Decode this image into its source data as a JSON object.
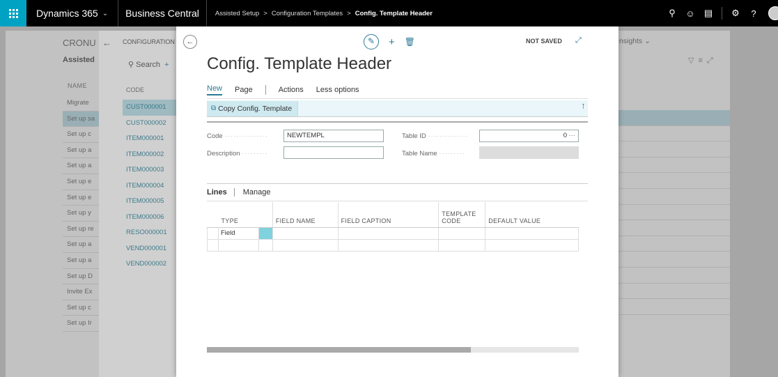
{
  "topbar": {
    "product": "Dynamics 365",
    "app": "Business Central",
    "breadcrumbs": [
      "Assisted Setup",
      "Configuration Templates",
      "Config. Template Header"
    ]
  },
  "background": {
    "company": "CRONU",
    "assisted": "Assisted",
    "name_header": "NAME",
    "rows": [
      "Migrate",
      "Set up sa",
      "Set up c",
      "Set up a",
      "Set up a",
      "Set up e",
      "Set up e",
      "Set up y",
      "Set up re",
      "Set up a",
      "Set up a",
      "Set up D",
      "Invite Ex",
      "Set up c",
      "Set up Ir"
    ],
    "selected_row": 1,
    "insights": "Insights"
  },
  "panel2": {
    "title": "CONFIGURATION TE",
    "search": "Search",
    "code_header": "CODE",
    "codes": [
      "CUST000001",
      "CUST000002",
      "ITEM000001",
      "ITEM000002",
      "ITEM000003",
      "ITEM000004",
      "ITEM000005",
      "ITEM000006",
      "RESO000001",
      "VEND000001",
      "VEND000002"
    ]
  },
  "dialog": {
    "status": "NOT SAVED",
    "title": "Config. Template Header",
    "actions": [
      "New",
      "Page",
      "Actions",
      "Less options"
    ],
    "copy_button": "Copy Config. Template",
    "fields": {
      "code_label": "Code",
      "code_value": "NEWTEMPL",
      "description_label": "Description",
      "description_value": "",
      "table_id_label": "Table ID",
      "table_id_value": "0",
      "table_name_label": "Table Name",
      "table_name_value": ""
    },
    "lines": {
      "tab_lines": "Lines",
      "tab_manage": "Manage",
      "columns": [
        "TYPE",
        "FIELD NAME",
        "FIELD CAPTION",
        "TEMPLATE CODE",
        "DEFAULT VALUE"
      ],
      "rows": [
        [
          "Field",
          "",
          "",
          "",
          ""
        ],
        [
          "",
          "",
          "",
          "",
          ""
        ]
      ]
    },
    "scroll_fraction": 0.71
  }
}
